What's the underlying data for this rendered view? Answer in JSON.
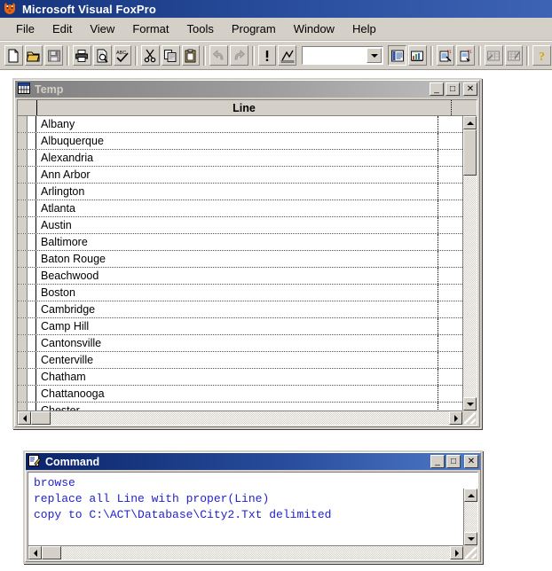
{
  "app": {
    "title": "Microsoft Visual FoxPro",
    "icon": "fox-icon",
    "background_color": "#ffffff",
    "titlebar_color": "#16347c"
  },
  "menubar": {
    "items": [
      {
        "label": "File"
      },
      {
        "label": "Edit"
      },
      {
        "label": "View"
      },
      {
        "label": "Format"
      },
      {
        "label": "Tools"
      },
      {
        "label": "Program"
      },
      {
        "label": "Window"
      },
      {
        "label": "Help"
      }
    ]
  },
  "toolbar": {
    "buttons": [
      {
        "name": "new-icon",
        "tooltip": "New"
      },
      {
        "name": "open-folder-icon",
        "tooltip": "Open"
      },
      {
        "name": "save-disk-icon",
        "tooltip": "Save"
      },
      {
        "name": "print-icon",
        "tooltip": "Print"
      },
      {
        "name": "print-preview-icon",
        "tooltip": "Print Preview"
      },
      {
        "name": "spell-check-icon",
        "tooltip": "Spelling"
      },
      {
        "name": "cut-scissors-icon",
        "tooltip": "Cut"
      },
      {
        "name": "copy-icon",
        "tooltip": "Copy"
      },
      {
        "name": "paste-clipboard-icon",
        "tooltip": "Paste"
      },
      {
        "name": "undo-arrow-icon",
        "tooltip": "Undo"
      },
      {
        "name": "redo-arrow-icon",
        "tooltip": "Redo"
      },
      {
        "name": "run-exclamation-icon",
        "tooltip": "Run"
      },
      {
        "name": "modify-form-icon",
        "tooltip": "Modify Form"
      },
      {
        "name": "form-designer-icon",
        "tooltip": "Form Designer"
      },
      {
        "name": "report-designer-icon",
        "tooltip": "Report Designer"
      },
      {
        "name": "database-designer-icon",
        "tooltip": "Database Designer"
      },
      {
        "name": "query-designer-icon",
        "tooltip": "Query Designer"
      },
      {
        "name": "view-designer-icon",
        "tooltip": "View Designer"
      },
      {
        "name": "table-designer-icon",
        "tooltip": "Table Designer"
      },
      {
        "name": "project-manager-icon",
        "tooltip": "Project Manager"
      },
      {
        "name": "help-question-icon",
        "tooltip": "Help"
      }
    ],
    "combo": {
      "value": "",
      "placeholder": ""
    }
  },
  "temp_window": {
    "title": "Temp",
    "icon": "table-grid-icon",
    "active": false,
    "minimize_label": "_",
    "maximize_label": "□",
    "close_label": "✕",
    "column_header": "Line",
    "rows": [
      {
        "value": "Albany"
      },
      {
        "value": "Albuquerque"
      },
      {
        "value": "Alexandria"
      },
      {
        "value": "Ann Arbor"
      },
      {
        "value": "Arlington"
      },
      {
        "value": "Atlanta"
      },
      {
        "value": "Austin"
      },
      {
        "value": "Baltimore"
      },
      {
        "value": "Baton Rouge"
      },
      {
        "value": "Beachwood"
      },
      {
        "value": "Boston"
      },
      {
        "value": "Cambridge"
      },
      {
        "value": "Camp Hill"
      },
      {
        "value": "Cantonsville"
      },
      {
        "value": "Centerville"
      },
      {
        "value": "Chatham"
      },
      {
        "value": "Chattanooga"
      },
      {
        "value": "Chester"
      }
    ]
  },
  "command_window": {
    "title": "Command",
    "icon": "command-edit-icon",
    "active": true,
    "minimize_label": "_",
    "maximize_label": "□",
    "close_label": "✕",
    "text_color": "#2222cc",
    "lines": [
      {
        "text": "browse"
      },
      {
        "text": "replace all Line with proper(Line)"
      },
      {
        "text": "copy to C:\\ACT\\Database\\City2.Txt delimited"
      }
    ]
  }
}
